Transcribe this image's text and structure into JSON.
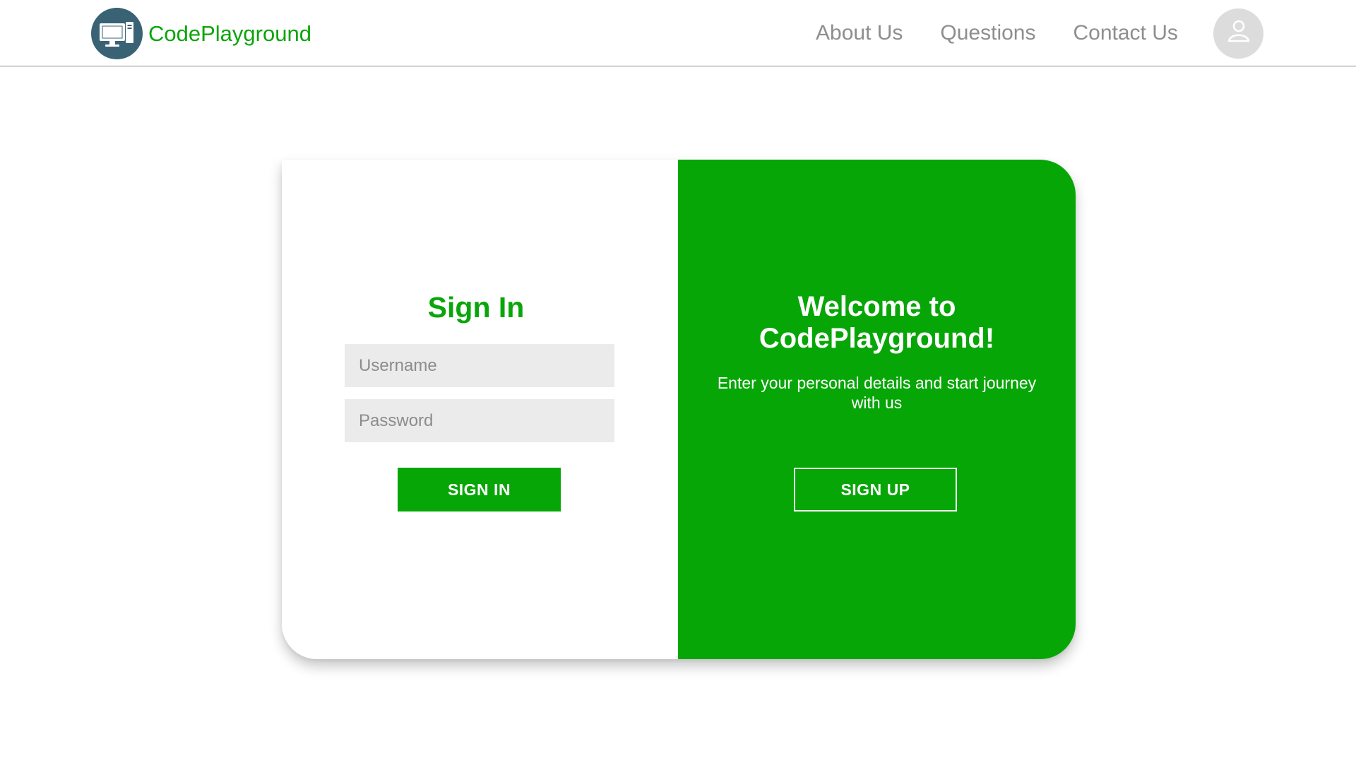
{
  "brand": {
    "logo_icon": "computer-monitor-icon",
    "name": "CodePlayground"
  },
  "nav": {
    "links": [
      "About Us",
      "Questions",
      "Contact Us"
    ],
    "avatar_icon": "user-icon"
  },
  "signin": {
    "title": "Sign In",
    "username_placeholder": "Username",
    "password_placeholder": "Password",
    "button_label": "SIGN IN"
  },
  "welcome": {
    "title": "Welcome to CodePlayground!",
    "text": "Enter your personal details and start journey with us",
    "button_label": "SIGN UP"
  },
  "colors": {
    "brand_green": "#07a607",
    "logo_bg": "#3a6275",
    "nav_text": "#8e8e8e",
    "input_bg": "#ebebeb"
  }
}
